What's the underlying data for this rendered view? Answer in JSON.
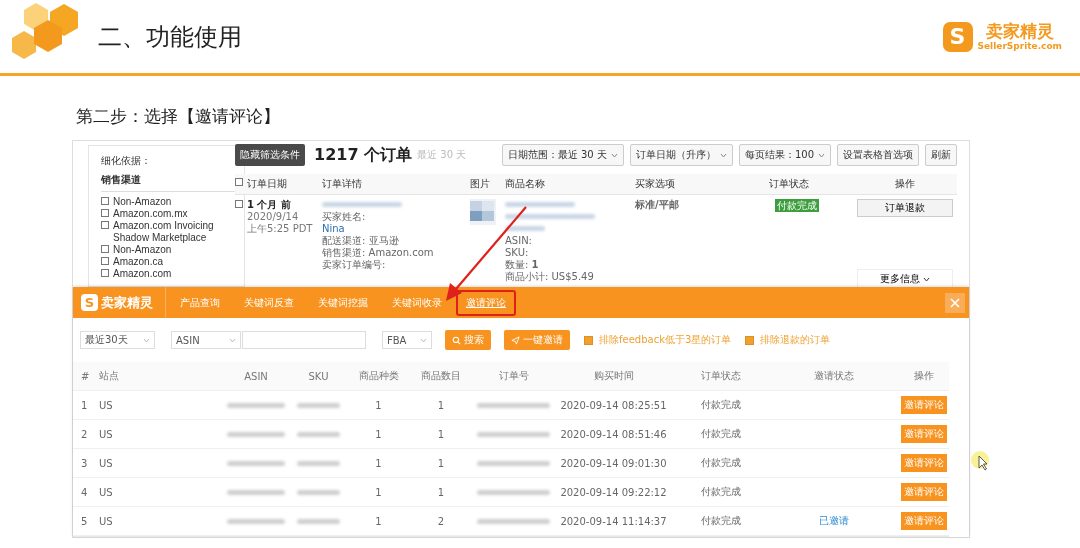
{
  "header": {
    "title": "二、功能使用",
    "logo": {
      "mark": "S",
      "name": "卖家精灵",
      "domain": "SellerSprite.com"
    }
  },
  "step_title": "第二步：选择【邀请评论】",
  "order_page": {
    "filter_panel": {
      "label": "细化依据：",
      "section": "销售渠道",
      "channels": [
        {
          "label": "Non-Amazon",
          "checked": false
        },
        {
          "label": "Amazon.com.mx",
          "checked": false
        },
        {
          "label": "Amazon.com Invoicing Shadow Marketplace",
          "checked": false
        },
        {
          "label": "Non-Amazon",
          "checked": false
        },
        {
          "label": "Amazon.ca",
          "checked": false
        },
        {
          "label": "Amazon.com",
          "checked": false
        }
      ]
    },
    "hide_button": "隐藏筛选条件",
    "count_title": "1217 个订单",
    "count_note": "最近 30 天",
    "dropdowns": [
      "日期范围：最近 30 天",
      "订单日期（升序）",
      "每页结果：100"
    ],
    "buttons": [
      "设置表格首选项",
      "刷新"
    ],
    "select_all_checked": false,
    "columns": [
      "订单日期",
      "订单详情",
      "图片",
      "商品名称",
      "买家选项",
      "订单状态",
      "操作"
    ],
    "order": {
      "checked": false,
      "age": "1 个月 前",
      "date": "2020/9/14",
      "time": "上午5:25 PDT",
      "details": [
        {
          "kind": "label",
          "text": "买家姓名:"
        },
        {
          "kind": "link",
          "text": "Nina"
        },
        {
          "kind": "label",
          "text": "配送渠道: 亚马逊"
        },
        {
          "kind": "label",
          "text": "销售渠道: Amazon.com"
        },
        {
          "kind": "label",
          "text": "卖家订单编号:"
        }
      ],
      "product": [
        "ASIN:",
        "SKU:",
        "数量: **1**",
        "商品小计: US$5.49"
      ],
      "buyer_option": "标准/平邮",
      "status": "付款完成",
      "action": "订单退款",
      "more": "更多信息"
    }
  },
  "plugin": {
    "logo": {
      "mark": "S",
      "name": "卖家精灵"
    },
    "nav": [
      {
        "label": "产品查询",
        "selected": false
      },
      {
        "label": "关键词反查",
        "selected": false
      },
      {
        "label": "关键词挖掘",
        "selected": false
      },
      {
        "label": "关键词收录",
        "selected": false
      },
      {
        "label": "邀请评论",
        "selected": true
      }
    ],
    "period": "最近30天",
    "field": "ASIN",
    "fulfillment": "FBA",
    "search_button": "搜索",
    "invite_all_button": "一键邀请",
    "options": [
      {
        "label": "排除feedback低于3星的订单",
        "checked": true
      },
      {
        "label": "排除退款的订单",
        "checked": true
      }
    ],
    "columns": [
      "#",
      "站点",
      "ASIN",
      "SKU",
      "商品种类",
      "商品数目",
      "订单号",
      "购买时间",
      "订单状态",
      "邀请状态",
      "操作"
    ],
    "rows": [
      {
        "index": "1",
        "site": "US",
        "variety": "1",
        "quantity": "1",
        "purchase_time": "2020-09-14 08:25:51",
        "order_status": "付款完成",
        "action": "邀请评论"
      },
      {
        "index": "2",
        "site": "US",
        "variety": "1",
        "quantity": "1",
        "purchase_time": "2020-09-14 08:51:46",
        "order_status": "付款完成",
        "action": "邀请评论"
      },
      {
        "index": "3",
        "site": "US",
        "variety": "1",
        "quantity": "1",
        "purchase_time": "2020-09-14 09:01:30",
        "order_status": "付款完成",
        "action": "邀请评论"
      },
      {
        "index": "4",
        "site": "US",
        "variety": "1",
        "quantity": "1",
        "purchase_time": "2020-09-14 09:22:12",
        "order_status": "付款完成",
        "action": "邀请评论"
      },
      {
        "index": "5",
        "site": "US",
        "variety": "1",
        "quantity": "2",
        "purchase_time": "2020-09-14 11:14:37",
        "order_status": "付款完成",
        "invite_status": "已邀请",
        "action": "邀请评论"
      }
    ]
  }
}
